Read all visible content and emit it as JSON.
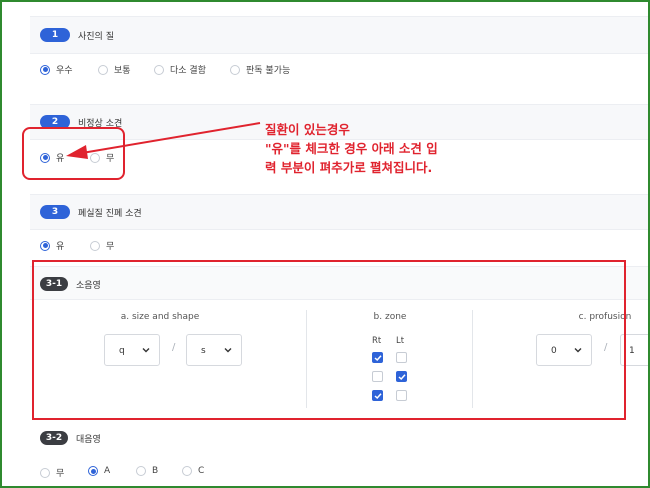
{
  "sections": {
    "s1": {
      "num": "1",
      "title": "사진의 질",
      "options": [
        "우수",
        "보통",
        "다소 결함",
        "판독 불가능"
      ],
      "selected": 0
    },
    "s2": {
      "num": "2",
      "title": "비정상 소견",
      "options": [
        "유",
        "무"
      ],
      "selected": 0
    },
    "s3": {
      "num": "3",
      "title": "폐실질 진폐 소견",
      "options": [
        "유",
        "무"
      ],
      "selected": 0
    },
    "s31": {
      "num": "3-1",
      "title": "소음영",
      "size_title": "a. size and shape",
      "size_sel1": "q",
      "size_sel2": "s",
      "zone_title": "b. zone",
      "zone_rt": "Rt",
      "zone_lt": "Lt",
      "zone_checks": [
        [
          true,
          false
        ],
        [
          false,
          true
        ],
        [
          true,
          false
        ]
      ],
      "prof_title": "c. profusion",
      "prof_sel1": "0",
      "prof_sel2": "1",
      "slash": "/"
    },
    "s32": {
      "num": "3-2",
      "title": "대음영",
      "options": [
        "무",
        "A",
        "B",
        "C"
      ],
      "selected": 1
    }
  },
  "annotation": {
    "line1": "질환이 있는경우",
    "line2": "\"유\"를 체크한 경우 아래 소견 입",
    "line3": "력 부분이 펴추가로 펼쳐집니다."
  },
  "colors": {
    "accent": "#2e63d8",
    "annotation": "#e0232e",
    "frame": "#2f8a2f"
  }
}
